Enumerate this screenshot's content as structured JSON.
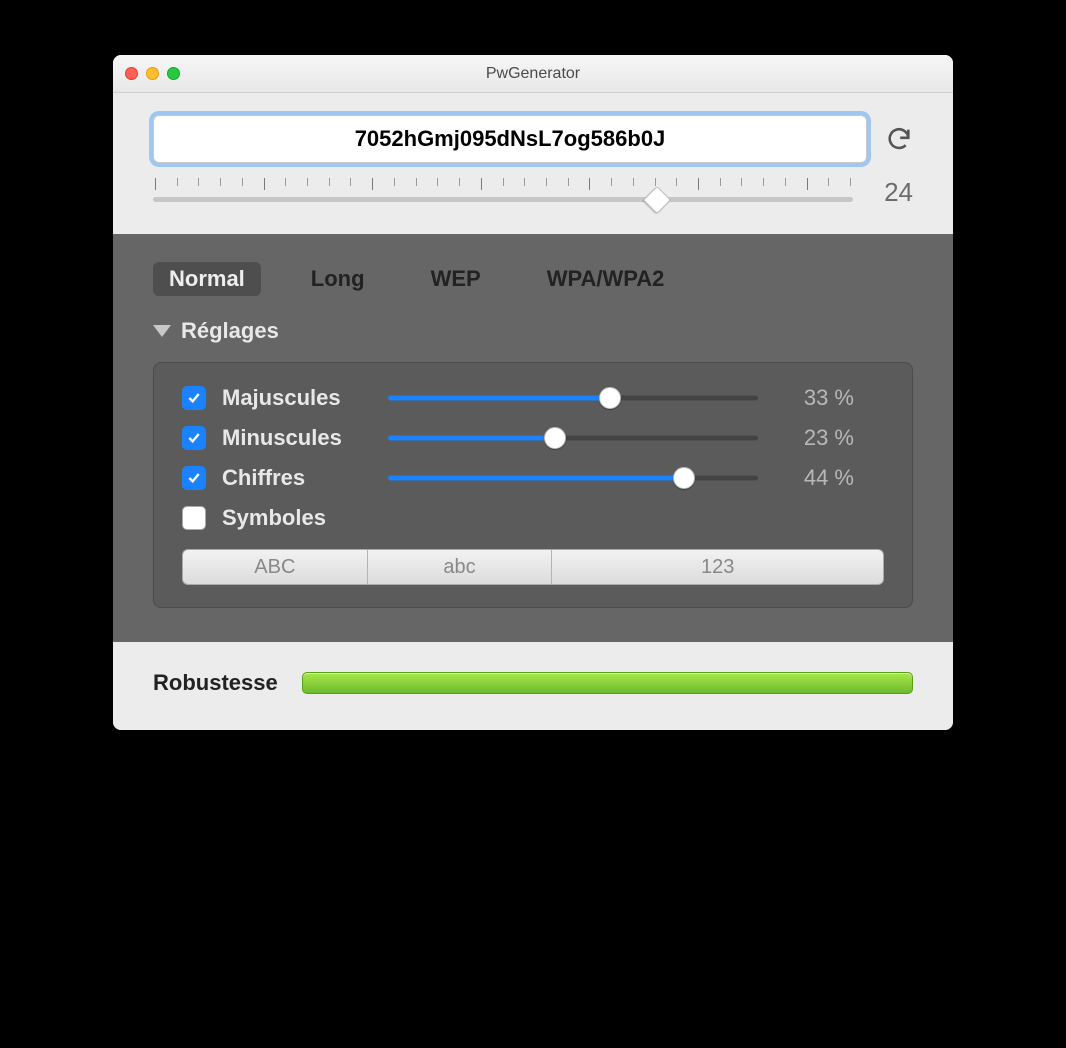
{
  "window": {
    "title": "PwGenerator"
  },
  "password": {
    "value": "7052hGmj095dNsL7og586b0J",
    "length": "24",
    "length_percent": 72
  },
  "tabs": [
    {
      "label": "Normal",
      "active": true
    },
    {
      "label": "Long",
      "active": false
    },
    {
      "label": "WEP",
      "active": false
    },
    {
      "label": "WPA/WPA2",
      "active": false
    }
  ],
  "settings_header": "Réglages",
  "options": {
    "uppercase": {
      "label": "Majuscules",
      "checked": true,
      "percent_label": "33 %",
      "percent": 60
    },
    "lowercase": {
      "label": "Minuscules",
      "checked": true,
      "percent_label": "23 %",
      "percent": 45
    },
    "digits": {
      "label": "Chiffres",
      "checked": true,
      "percent_label": "44 %",
      "percent": 80
    },
    "symbols": {
      "label": "Symboles",
      "checked": false
    }
  },
  "segments": {
    "upper": "ABC",
    "lower": "abc",
    "digits": "123"
  },
  "robustness": {
    "label": "Robustesse",
    "percent": 100
  }
}
